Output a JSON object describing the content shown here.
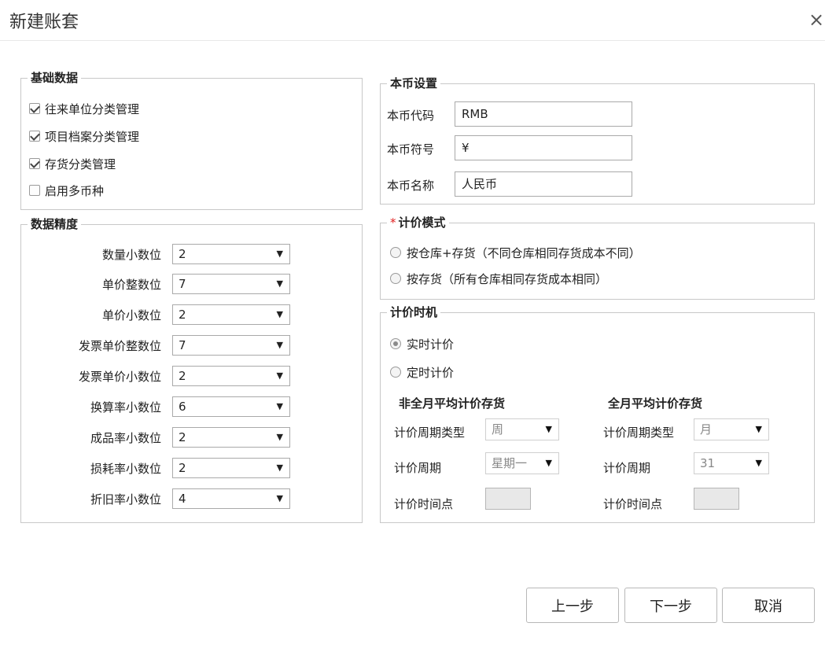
{
  "dialog": {
    "title": "新建账套",
    "close_icon": "×"
  },
  "basic": {
    "legend": "基础数据",
    "items": [
      {
        "label": "往来单位分类管理",
        "checked": true
      },
      {
        "label": "项目档案分类管理",
        "checked": true
      },
      {
        "label": "存货分类管理",
        "checked": true
      },
      {
        "label": "启用多币种",
        "checked": false
      }
    ]
  },
  "precision": {
    "legend": "数据精度",
    "rows": [
      {
        "label": "数量小数位",
        "value": "2"
      },
      {
        "label": "单价整数位",
        "value": "7"
      },
      {
        "label": "单价小数位",
        "value": "2"
      },
      {
        "label": "发票单价整数位",
        "value": "7"
      },
      {
        "label": "发票单价小数位",
        "value": "2"
      },
      {
        "label": "换算率小数位",
        "value": "6"
      },
      {
        "label": "成品率小数位",
        "value": "2"
      },
      {
        "label": "损耗率小数位",
        "value": "2"
      },
      {
        "label": "折旧率小数位",
        "value": "4"
      }
    ],
    "arrow": "▼"
  },
  "currency": {
    "legend": "本币设置",
    "code_label": "本币代码",
    "code_value": "RMB",
    "symbol_label": "本币符号",
    "symbol_value": "¥",
    "name_label": "本币名称",
    "name_value": "人民币"
  },
  "pricing_mode": {
    "required_mark": "*",
    "legend": "计价模式",
    "options": [
      {
        "label": "按仓库+存货（不同仓库相同存货成本不同）",
        "checked": false
      },
      {
        "label": "按存货（所有仓库相同存货成本相同）",
        "checked": false
      }
    ]
  },
  "pricing_timing": {
    "legend": "计价时机",
    "options": [
      {
        "label": "实时计价",
        "checked": true
      },
      {
        "label": "定时计价",
        "checked": false
      }
    ],
    "non_full": {
      "title": "非全月平均计价存货",
      "period_type_label": "计价周期类型",
      "period_type_value": "周",
      "period_label": "计价周期",
      "period_value": "星期一",
      "time_label": "计价时间点"
    },
    "full": {
      "title": "全月平均计价存货",
      "period_type_label": "计价周期类型",
      "period_type_value": "月",
      "period_label": "计价周期",
      "period_value": "31",
      "time_label": "计价时间点"
    }
  },
  "footer": {
    "prev_label": "上一步",
    "next_label": "下一步",
    "cancel_label": "取消"
  }
}
